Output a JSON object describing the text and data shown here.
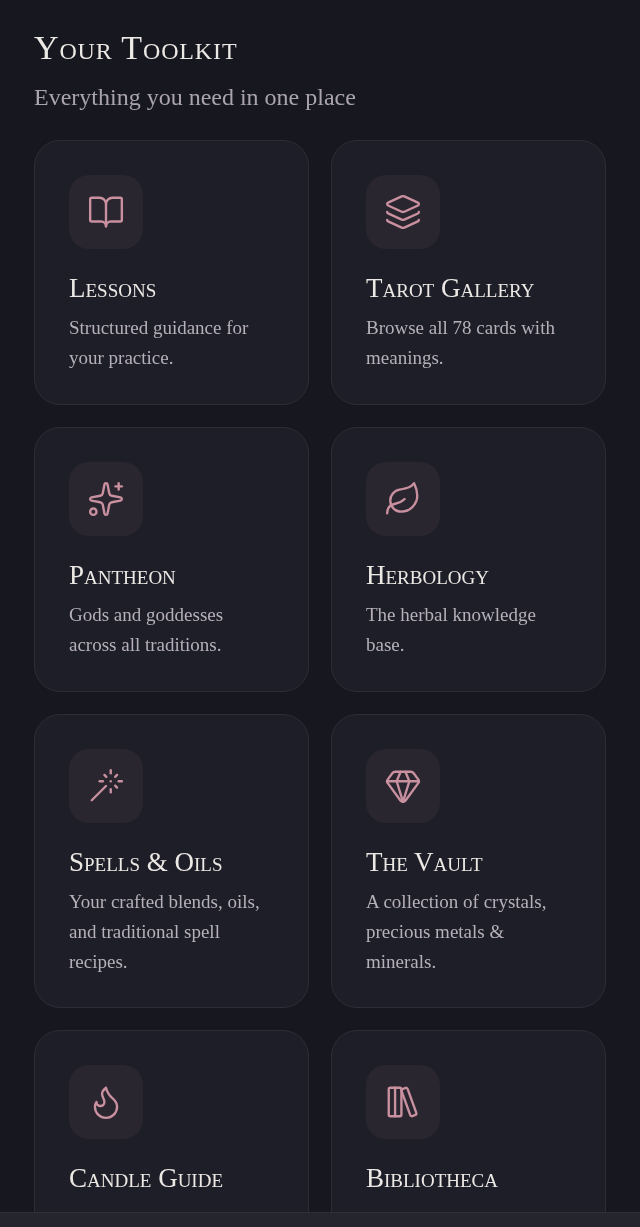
{
  "header": {
    "title": "Your Toolkit",
    "subtitle": "Everything you need in one place"
  },
  "cards": [
    {
      "title": "Lessons",
      "description": "Structured guidance for your practice."
    },
    {
      "title": "Tarot Gallery",
      "description": "Browse all 78 cards with meanings."
    },
    {
      "title": "Pantheon",
      "description": "Gods and goddesses across all traditions."
    },
    {
      "title": "Herbology",
      "description": "The herbal knowledge base."
    },
    {
      "title": "Spells & Oils",
      "description": "Your crafted blends, oils, and traditional spell recipes."
    },
    {
      "title": "The Vault",
      "description": "A collection of crystals, precious metals & minerals."
    },
    {
      "title": "Candle Guide"
    },
    {
      "title": "Bibliotheca"
    }
  ]
}
